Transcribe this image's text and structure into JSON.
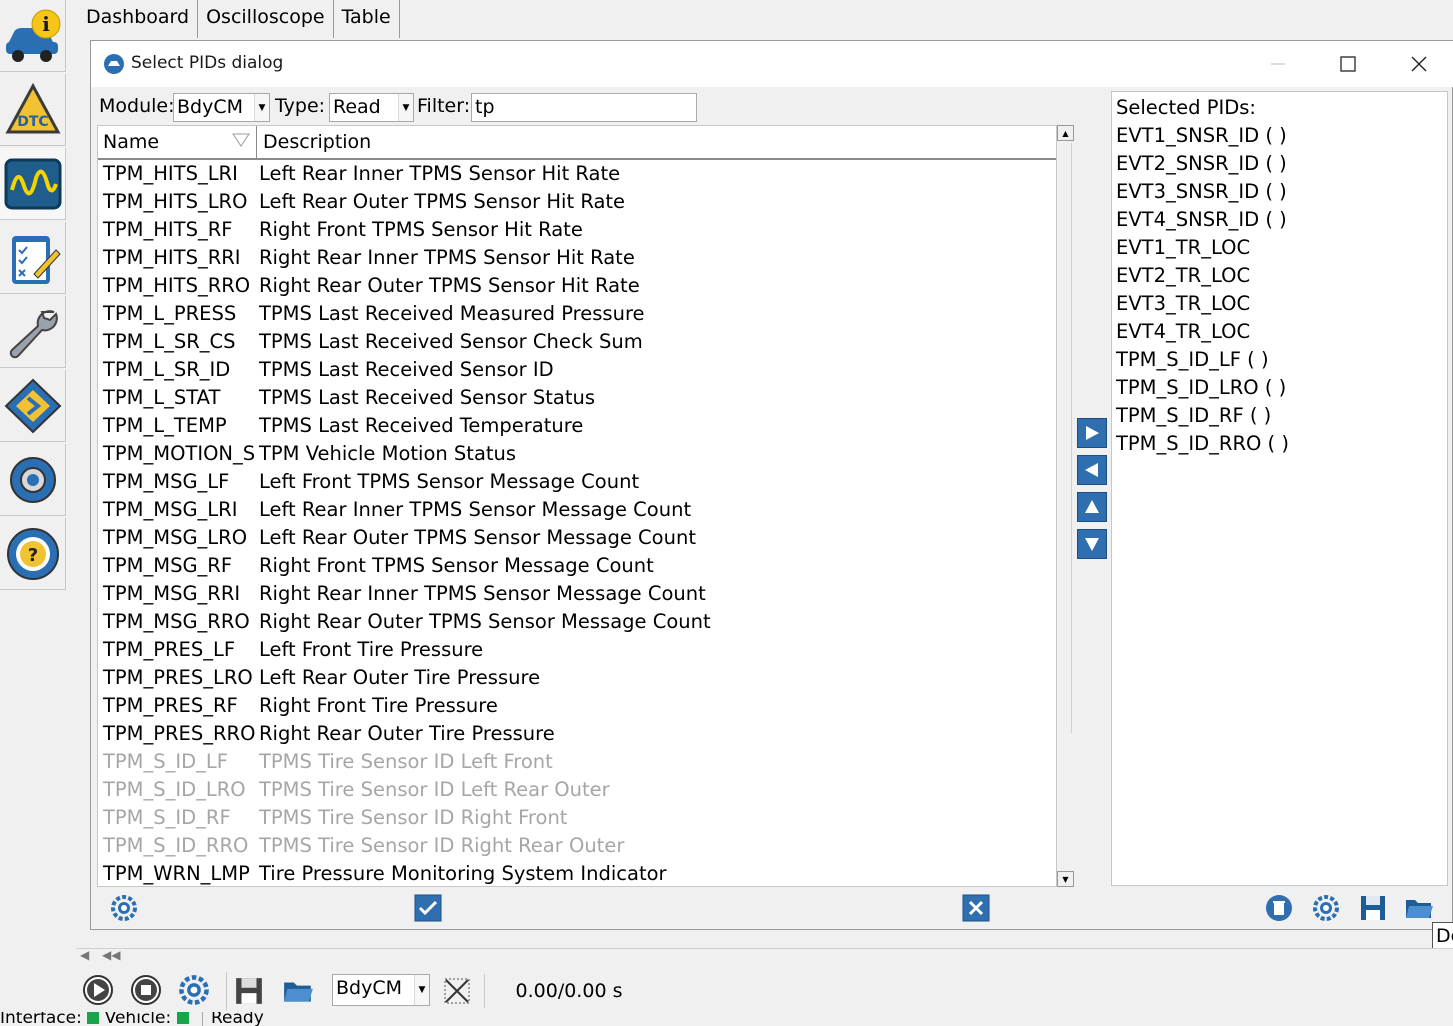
{
  "sidebar": {
    "items": [
      {
        "name": "vehicle-info",
        "label": "i"
      },
      {
        "name": "dtc",
        "label": "DTC"
      },
      {
        "name": "oscilloscope",
        "label": ""
      },
      {
        "name": "checklist",
        "label": ""
      },
      {
        "name": "service",
        "label": ""
      },
      {
        "name": "module",
        "label": ""
      },
      {
        "name": "settings",
        "label": ""
      },
      {
        "name": "help",
        "label": "?"
      }
    ]
  },
  "tabs": [
    "Dashboard",
    "Oscilloscope",
    "Table"
  ],
  "dialog": {
    "title": "Select PIDs dialog",
    "module_label": "Module:",
    "module_value": "BdyCM",
    "type_label": "Type:",
    "type_value": "Read",
    "filter_label": "Filter:",
    "filter_value": "tp",
    "columns": {
      "name": "Name",
      "description": "Description"
    },
    "rows": [
      {
        "name": "TPM_HITS_LRI",
        "desc": "Left Rear Inner TPMS Sensor Hit Rate",
        "disabled": false
      },
      {
        "name": "TPM_HITS_LRO",
        "desc": "Left Rear Outer TPMS Sensor Hit Rate",
        "disabled": false
      },
      {
        "name": "TPM_HITS_RF",
        "desc": "Right Front TPMS Sensor Hit Rate",
        "disabled": false
      },
      {
        "name": "TPM_HITS_RRI",
        "desc": "Right Rear Inner TPMS Sensor Hit Rate",
        "disabled": false
      },
      {
        "name": "TPM_HITS_RRO",
        "desc": "Right Rear Outer TPMS Sensor Hit Rate",
        "disabled": false
      },
      {
        "name": "TPM_L_PRESS",
        "desc": "TPMS Last Received Measured Pressure",
        "disabled": false
      },
      {
        "name": "TPM_L_SR_CS",
        "desc": "TPMS Last Received Sensor Check Sum",
        "disabled": false
      },
      {
        "name": "TPM_L_SR_ID",
        "desc": "TPMS Last Received Sensor ID",
        "disabled": false
      },
      {
        "name": "TPM_L_STAT",
        "desc": "TPMS Last Received Sensor Status",
        "disabled": false
      },
      {
        "name": "TPM_L_TEMP",
        "desc": "TPMS Last Received Temperature",
        "disabled": false
      },
      {
        "name": "TPM_MOTION_S",
        "desc": "TPM Vehicle Motion Status",
        "disabled": false
      },
      {
        "name": "TPM_MSG_LF",
        "desc": "Left Front TPMS Sensor Message Count",
        "disabled": false
      },
      {
        "name": "TPM_MSG_LRI",
        "desc": "Left Rear Inner TPMS Sensor Message Count",
        "disabled": false
      },
      {
        "name": "TPM_MSG_LRO",
        "desc": "Left Rear Outer TPMS Sensor Message Count",
        "disabled": false
      },
      {
        "name": "TPM_MSG_RF",
        "desc": "Right Front TPMS Sensor Message Count",
        "disabled": false
      },
      {
        "name": "TPM_MSG_RRI",
        "desc": "Right Rear Inner TPMS Sensor Message Count",
        "disabled": false
      },
      {
        "name": "TPM_MSG_RRO",
        "desc": "Right Rear Outer TPMS Sensor Message Count",
        "disabled": false
      },
      {
        "name": "TPM_PRES_LF",
        "desc": "Left Front Tire Pressure",
        "disabled": false
      },
      {
        "name": "TPM_PRES_LRO",
        "desc": "Left Rear Outer Tire Pressure",
        "disabled": false
      },
      {
        "name": "TPM_PRES_RF",
        "desc": "Right Front Tire Pressure",
        "disabled": false
      },
      {
        "name": "TPM_PRES_RRO",
        "desc": "Right Rear Outer Tire Pressure",
        "disabled": false
      },
      {
        "name": "TPM_S_ID_LF",
        "desc": "TPMS Tire Sensor ID Left Front",
        "disabled": true
      },
      {
        "name": "TPM_S_ID_LRO",
        "desc": "TPMS Tire Sensor ID Left Rear Outer",
        "disabled": true
      },
      {
        "name": "TPM_S_ID_RF",
        "desc": "TPMS Tire Sensor ID Right Front",
        "disabled": true
      },
      {
        "name": "TPM_S_ID_RRO",
        "desc": "TPMS Tire Sensor ID Right Rear Outer",
        "disabled": true
      },
      {
        "name": "TPM_WRN_LMP",
        "desc": "Tire Pressure Monitoring System Indicator",
        "disabled": false
      }
    ],
    "selected_label": "Selected PIDs:",
    "selected": [
      "EVT1_SNSR_ID ( )",
      "EVT2_SNSR_ID ( )",
      "EVT3_SNSR_ID ( )",
      "EVT4_SNSR_ID ( )",
      "EVT1_TR_LOC",
      "EVT2_TR_LOC",
      "EVT3_TR_LOC",
      "EVT4_TR_LOC",
      "TPM_S_ID_LF ( )",
      "TPM_S_ID_LRO ( )",
      "TPM_S_ID_RF ( )",
      "TPM_S_ID_RRO ( )"
    ]
  },
  "controls": {
    "module_value": "BdyCM",
    "time_readout": "0.00/0.00 s"
  },
  "tooltip_fragment": "De",
  "status": {
    "interface_label": "Interface:",
    "vehicle_label": "Vehicle:",
    "state": "Ready"
  },
  "colors": {
    "accent_blue": "#2f6fb0",
    "disabled_text": "#a6a6a6",
    "led_green": "#19a34a"
  }
}
